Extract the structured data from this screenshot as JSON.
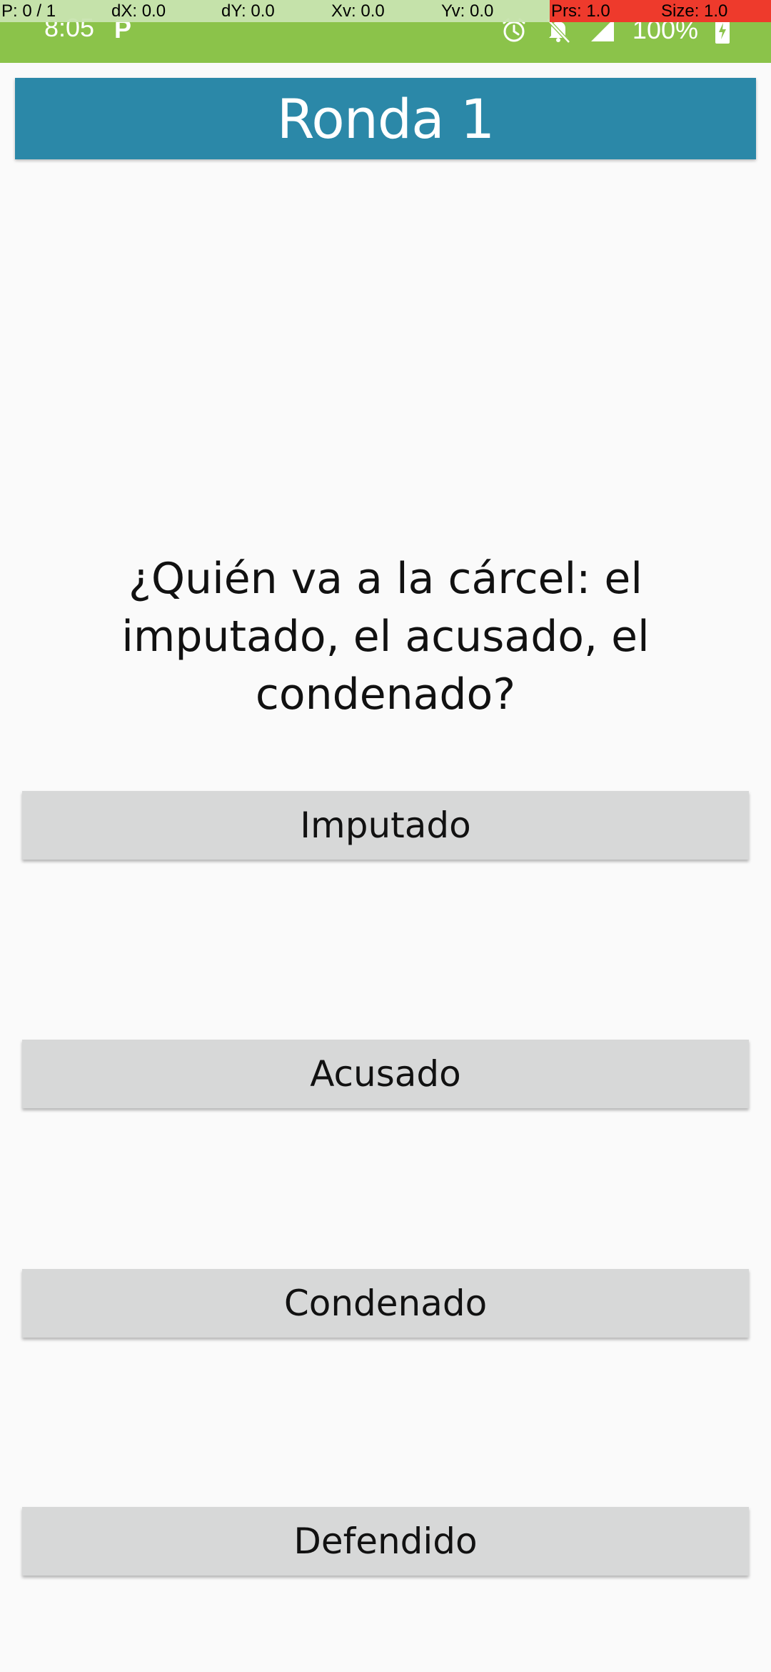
{
  "status_bar": {
    "time": "8:05",
    "app_icon_glyph": "P",
    "battery": "100%",
    "icons": [
      "alarm-icon",
      "bell-off-icon",
      "signal-icon",
      "battery-charging-icon"
    ],
    "background_color": "#8bc34a"
  },
  "debug_overlay": {
    "pointer": "P: 0 / 1",
    "dx": "dX: 0.0",
    "dy": "dY: 0.0",
    "xv": "Xv: 0.0",
    "yv": "Yv: 0.0",
    "prs": "Prs: 1.0",
    "size": "Size: 1.0"
  },
  "header": {
    "title": "Ronda 1",
    "background_color": "#2b88a8"
  },
  "question": {
    "text": "¿Quién va a la cárcel: el imputado, el acusado, el condenado?"
  },
  "answers": [
    {
      "label": "Imputado"
    },
    {
      "label": "Acusado"
    },
    {
      "label": "Condenado"
    },
    {
      "label": "Defendido"
    }
  ]
}
